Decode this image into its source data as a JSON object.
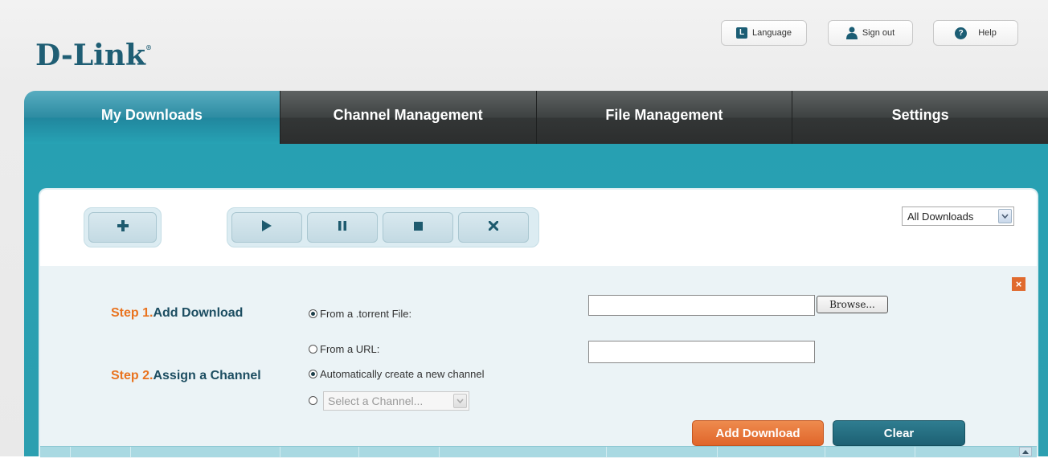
{
  "brand": {
    "logo": "D-Link",
    "reg_mark": "®"
  },
  "header": {
    "language_label": "Language",
    "language_icon": "L",
    "signout_label": "Sign out",
    "help_label": "Help",
    "help_icon": "?"
  },
  "tabs": [
    {
      "label": "My Downloads",
      "active": true
    },
    {
      "label": "Channel Management",
      "active": false
    },
    {
      "label": "File Management",
      "active": false
    },
    {
      "label": "Settings",
      "active": false
    }
  ],
  "toolbar": {
    "add_icon": "plus-icon",
    "controls": [
      "play-icon",
      "pause-icon",
      "stop-icon",
      "delete-icon"
    ],
    "filter_value": "All Downloads"
  },
  "form": {
    "close_icon": "×",
    "step1_num": "Step 1.",
    "step1_text": "Add Download",
    "step2_num": "Step 2.",
    "step2_text": "Assign a Channel",
    "opt_torrent": "From a .torrent File:",
    "opt_url": "From a URL:",
    "opt_auto": "Automatically create a new channel",
    "channel_placeholder": "Select a Channel...",
    "browse_label": "Browse...",
    "add_label": "Add Download",
    "clear_label": "Clear",
    "selected_source": "torrent",
    "selected_channel": "auto"
  },
  "colors": {
    "teal": "#27a0b2",
    "brand_blue": "#1f5e74",
    "orange": "#e9731f"
  }
}
